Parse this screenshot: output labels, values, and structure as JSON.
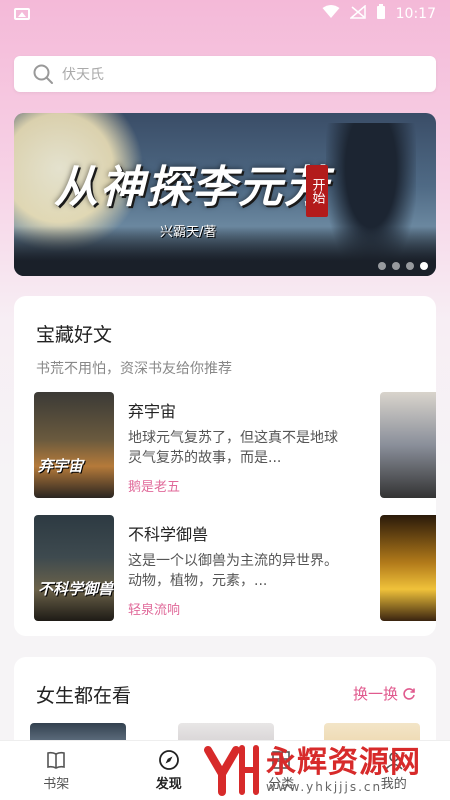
{
  "status_bar": {
    "time": "10:17"
  },
  "search": {
    "placeholder": "伏天氏"
  },
  "banner": {
    "title": "从神探李元芳",
    "seal": "开始",
    "author": "兴霸天/著",
    "dots": 4
  },
  "section1": {
    "title": "宝藏好文",
    "subtitle": "书荒不用怕，资深书友给你推荐",
    "books": [
      {
        "title": "弃宇宙",
        "desc": "地球元气复苏了，但这真不是地球灵气复苏的故事，而是...",
        "author": "鹅是老五",
        "cover_text": "弃宇宙"
      },
      {
        "title": "不科学御兽",
        "desc": "这是一个以御兽为主流的异世界。动物，植物，元素，...",
        "author": "轻泉流响",
        "cover_text": "不科学御兽"
      }
    ]
  },
  "section2": {
    "title": "女生都在看",
    "refresh_label": "换一换"
  },
  "tabs": [
    {
      "label": "书架",
      "icon": "book-icon"
    },
    {
      "label": "发现",
      "icon": "compass-icon"
    },
    {
      "label": "分类",
      "icon": "grid-icon"
    },
    {
      "label": "我的",
      "icon": "user-icon"
    }
  ],
  "watermark": {
    "main": "永辉资源网",
    "sub": "www.yhkjjjs.cn"
  },
  "colors": {
    "accent": "#e05a8e",
    "author": "#e06a9a"
  }
}
